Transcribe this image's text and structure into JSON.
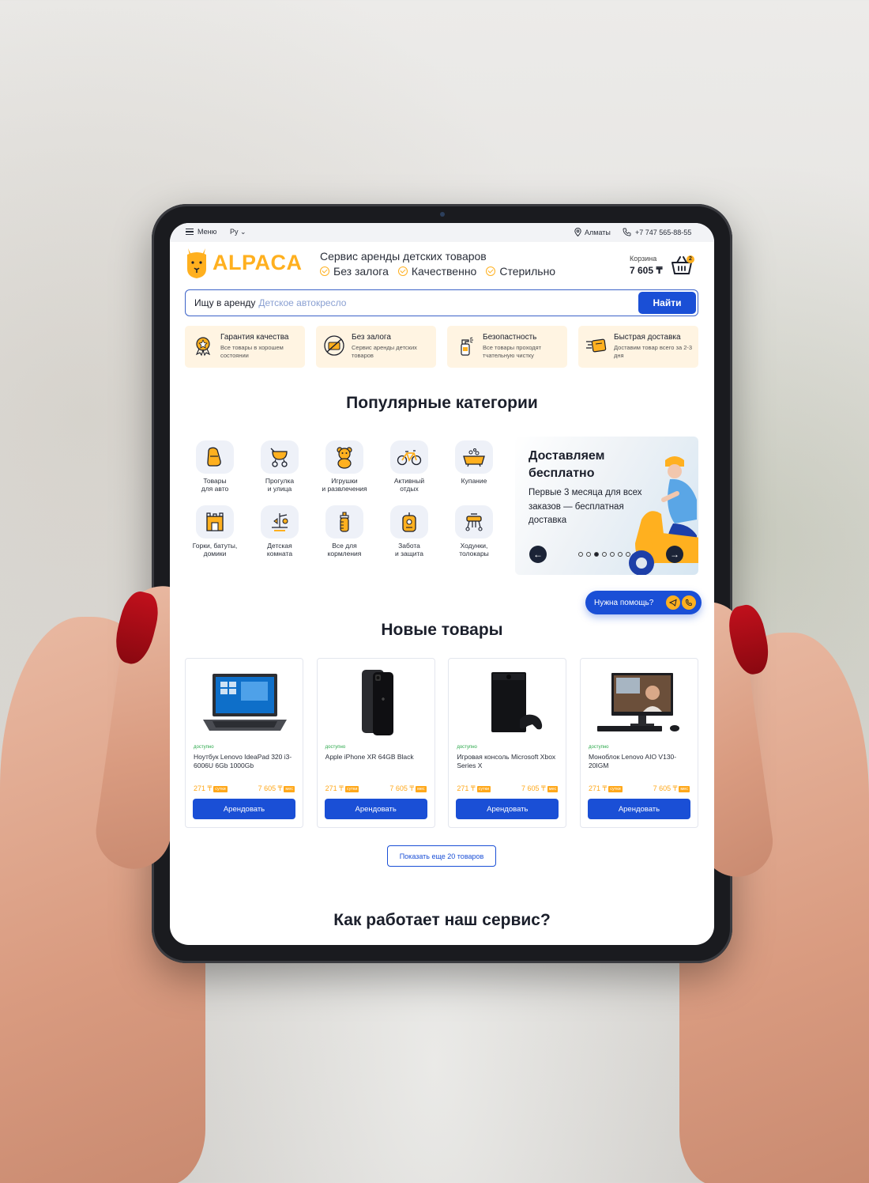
{
  "topbar": {
    "menu_label": "Меню",
    "lang": "Ру",
    "city": "Алматы",
    "phone": "+7 747 565-88-55"
  },
  "header": {
    "logo": "ALPACA",
    "slogan": "Сервис аренды детских товаров",
    "features": [
      "Без залога",
      "Качественно",
      "Стерильно"
    ],
    "cart_label": "Корзина",
    "cart_total": "7 605 ₸",
    "cart_count": "2"
  },
  "search": {
    "prefix": "Ищу в аренду",
    "placeholder": "Детское автокресло",
    "button": "Найти"
  },
  "benefits": [
    {
      "title": "Гарантия качества",
      "desc": "Все товары в хорошем состоянии",
      "icon": "quality-badge-icon"
    },
    {
      "title": "Без залога",
      "desc": "Сервис аренды детских товаров",
      "icon": "no-deposit-icon"
    },
    {
      "title": "Безопастность",
      "desc": "Все товары проходят тчательную чистку",
      "icon": "spray-bottle-icon"
    },
    {
      "title": "Быстрая доставка",
      "desc": "Доставим товар всего за 2-3 дня",
      "icon": "fast-delivery-icon"
    }
  ],
  "categories_title": "Популярные категории",
  "categories": [
    {
      "label": "Товары\nдля авто",
      "icon": "car-seat-icon"
    },
    {
      "label": "Прогулка\nи улица",
      "icon": "stroller-icon"
    },
    {
      "label": "Игрушки\nи развлечения",
      "icon": "teddy-bear-icon"
    },
    {
      "label": "Активный\nотдых",
      "icon": "bicycle-icon"
    },
    {
      "label": "Купание",
      "icon": "bathtub-icon"
    },
    {
      "label": "Горки, батуты,\nдомики",
      "icon": "playhouse-icon"
    },
    {
      "label": "Детская\nкомната",
      "icon": "mobile-toy-icon"
    },
    {
      "label": "Все для\nкормления",
      "icon": "baby-bottle-icon"
    },
    {
      "label": "Забота\nи защита",
      "icon": "baby-monitor-icon"
    },
    {
      "label": "Ходунки,\nтолокары",
      "icon": "walker-icon"
    }
  ],
  "promo": {
    "title": "Доставляем бесплатно",
    "desc": "Первые 3 месяца для всех заказов — бесплатная доставка",
    "slides": 7,
    "active_slide": 3
  },
  "help": {
    "label": "Нужна помощь?"
  },
  "new_title": "Новые товары",
  "products": [
    {
      "status": "доступно",
      "name": "Ноутбук Lenovo IdeaPad 320 i3-6006U 6Gb 1000Gb",
      "price_day": "271 ₸",
      "day_tag": "сутки",
      "price_month": "7 605 ₸",
      "month_tag": "мес",
      "button": "Арендовать",
      "image": "laptop"
    },
    {
      "status": "доступно",
      "name": "Apple iPhone XR 64GB Black",
      "price_day": "271 ₸",
      "day_tag": "сутки",
      "price_month": "7 605 ₸",
      "month_tag": "мес",
      "button": "Арендовать",
      "image": "phone"
    },
    {
      "status": "доступно",
      "name": "Игровая консоль Microsoft Xbox Series X",
      "price_day": "271 ₸",
      "day_tag": "сутки",
      "price_month": "7 605 ₸",
      "month_tag": "мес",
      "button": "Арендовать",
      "image": "console"
    },
    {
      "status": "доступно",
      "name": "Моноблок Lenovo AIO V130-20IGM",
      "price_day": "271 ₸",
      "day_tag": "сутки",
      "price_month": "7 605 ₸",
      "month_tag": "мес",
      "button": "Арендовать",
      "image": "monoblock"
    }
  ],
  "more_button": "Показать еще 20 товаров",
  "how_title": "Как работает наш сервис?",
  "colors": {
    "accent": "#1a4fd6",
    "brand": "#ffb01f",
    "benefit_bg": "#fff4e2"
  }
}
